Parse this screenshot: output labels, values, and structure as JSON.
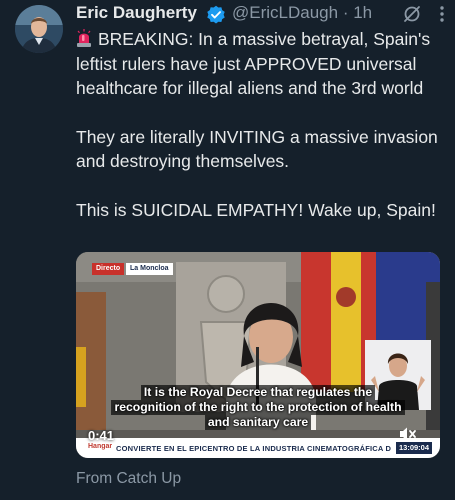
{
  "author": {
    "name": "Eric Daugherty",
    "handle": "@EricLDaugh",
    "time": "1h",
    "verified": true,
    "avatar_icon": "avatar-photo"
  },
  "post": {
    "paragraphs": [
      "BREAKING: In a massive betrayal, Spain's leftist rulers have just APPROVED universal healthcare for illegal aliens and the 3rd world",
      "They are literally INVITING a massive invasion and destroying themselves.",
      "This is SUICIDAL EMPATHY! Wake up, Spain!"
    ],
    "leading_emoji": "police-siren-icon"
  },
  "video": {
    "badge_live": "Directo",
    "badge_place": "La Moncloa",
    "subtitle_lines": [
      "It is the Royal Decree that regulates the",
      "recognition of the right to the protection of health",
      "and sanitary care"
    ],
    "duration": "0:41",
    "ticker": "CONVIERTE EN EL EPICENTRO DE LA INDUSTRIA CINEMATOGRÁFICA DE NUESTRO",
    "clock": "13:09:04",
    "mark": "Hangar"
  },
  "attribution": "From Catch Up",
  "colors": {
    "background": "#15202b",
    "text": "#e7e9ea",
    "muted": "#8b98a5",
    "verified": "#1d9bf0",
    "siren": "#e0245e"
  }
}
